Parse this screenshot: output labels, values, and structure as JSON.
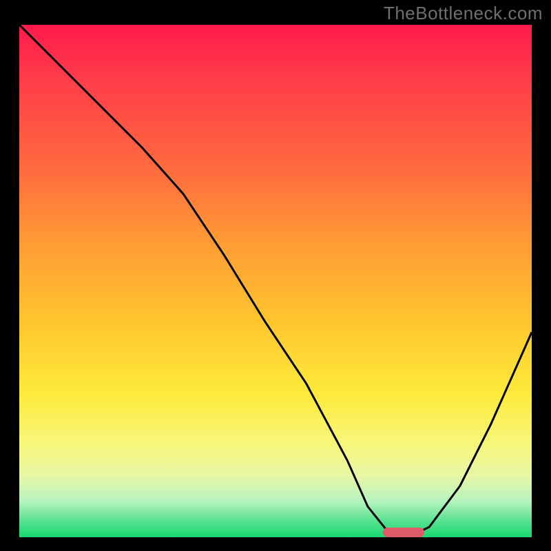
{
  "watermark": "TheBottleneck.com",
  "colors": {
    "page_bg": "#000000",
    "watermark": "#6f6f6f",
    "curve": "#000000",
    "pill": "#e05a6a",
    "gradient_top": "#ff1a4b",
    "gradient_bottom": "#17d96f"
  },
  "chart_data": {
    "type": "line",
    "title": "",
    "xlabel": "",
    "ylabel": "",
    "xlim": [
      0,
      100
    ],
    "ylim": [
      0,
      100
    ],
    "grid": false,
    "note": "No axis tick labels are shown; x and y data are estimated from pixel positions on a 0–100 scale.",
    "series": [
      {
        "name": "curve",
        "x": [
          0,
          10,
          18,
          24,
          32,
          40,
          48,
          56,
          64,
          68,
          72,
          76,
          80,
          86,
          92,
          100
        ],
        "y": [
          100,
          90,
          82,
          76,
          67,
          55,
          42,
          30,
          15,
          6,
          1,
          0,
          2,
          10,
          22,
          40
        ]
      }
    ],
    "marker": {
      "name": "optimum-pill",
      "x_range": [
        71,
        79
      ],
      "y": 1,
      "color": "#e05a6a"
    }
  }
}
